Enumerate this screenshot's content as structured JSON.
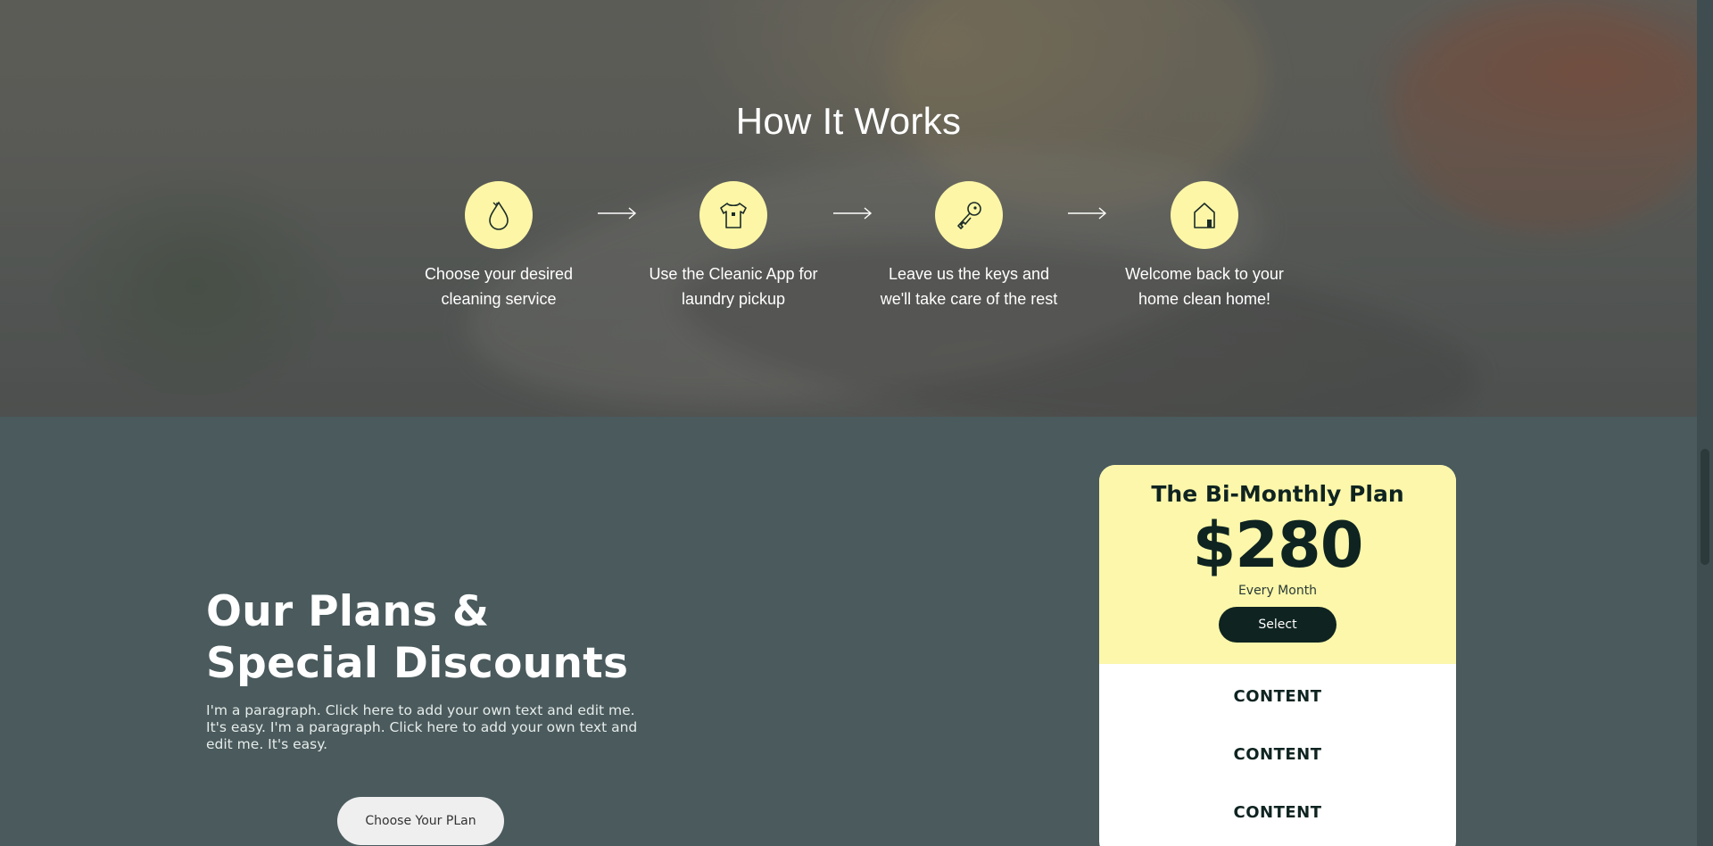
{
  "how_it_works": {
    "title": "How It Works",
    "steps": [
      {
        "icon": "water-drop-icon",
        "text_line1": "Choose your desired",
        "text_line2": "cleaning service"
      },
      {
        "icon": "tshirt-icon",
        "text_line1": "Use the Cleanic App for",
        "text_line2": "laundry pickup"
      },
      {
        "icon": "key-icon",
        "text_line1": "Leave us the keys and",
        "text_line2": "we'll take care of the rest"
      },
      {
        "icon": "house-icon",
        "text_line1": "Welcome back to your",
        "text_line2": "home clean home!"
      }
    ]
  },
  "plans_section": {
    "heading_line1": "Our Plans &",
    "heading_line2": "Special Discounts",
    "paragraph": "I'm a paragraph. Click here to add your own text and edit me. It's easy. I'm a paragraph. Click here to add your own text and edit me. It's easy.",
    "cta_label": "Choose Your PLan"
  },
  "plan_card": {
    "name": "The Bi-Monthly Plan",
    "price": "$280",
    "period": "Every Month",
    "select_label": "Select",
    "items": [
      "CONTENT",
      "CONTENT",
      "CONTENT"
    ]
  },
  "colors": {
    "accent_yellow": "#fcf7aa",
    "dark_green": "#0f2421",
    "section_bg": "#4a5a5d"
  }
}
